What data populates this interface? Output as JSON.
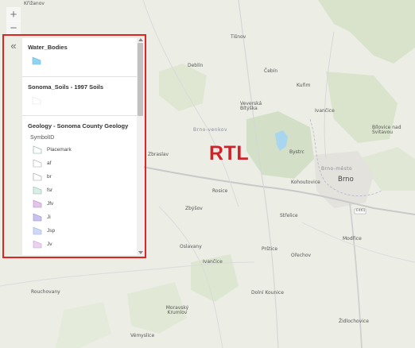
{
  "map": {
    "annotation": "RTL",
    "towns": [
      {
        "name": "Křižanov"
      },
      {
        "name": "Tišnov"
      },
      {
        "name": "Deblín"
      },
      {
        "name": "Čebín"
      },
      {
        "name": "Kuřim"
      },
      {
        "name": "Veverská Bítýška"
      },
      {
        "name": "Ivančice"
      },
      {
        "name": "Bílovice nad Svitavou"
      },
      {
        "name": "Brno-venkov"
      },
      {
        "name": "Zbraslav"
      },
      {
        "name": "Bystrc"
      },
      {
        "name": "Brno-město"
      },
      {
        "name": "Kohoutovice"
      },
      {
        "name": "Brno"
      },
      {
        "name": "Rosice"
      },
      {
        "name": "Zbýšov"
      },
      {
        "name": "Střelice"
      },
      {
        "name": "Modřice"
      },
      {
        "name": "Oslavany"
      },
      {
        "name": "Prštice"
      },
      {
        "name": "Ořechov"
      },
      {
        "name": "Ivančice"
      },
      {
        "name": "Rouchovany"
      },
      {
        "name": "Dolní Kounice"
      },
      {
        "name": "Moravský Krumlov"
      },
      {
        "name": "Židlochovice"
      },
      {
        "name": "Vémyslice"
      }
    ],
    "road_label": "E461"
  },
  "controls": {
    "zoom_in": "+",
    "zoom_out": "−",
    "collapse": "«"
  },
  "legend": {
    "layers": [
      {
        "title": "Water_Bodies"
      },
      {
        "title": "Sonoma_Soils - 1997 Soils"
      },
      {
        "title": "Geology - Sonoma County Geology",
        "field": "SymbolID",
        "items": [
          {
            "label": "Placemark",
            "color": "#ffffff",
            "stroke": "#7fa3a0"
          },
          {
            "label": "af",
            "color": "#ffffff",
            "stroke": "#9aa7b5"
          },
          {
            "label": "br",
            "color": "#ffffff",
            "stroke": "#9a9a9a"
          },
          {
            "label": "fsr",
            "color": "#d8efe6",
            "stroke": "#8fb8a8"
          },
          {
            "label": "Jfv",
            "color": "#e3c4ea",
            "stroke": "#b48cc0"
          },
          {
            "label": "Ji",
            "color": "#c9c1ef",
            "stroke": "#9a8fd0"
          },
          {
            "label": "Jsp",
            "color": "#cfd9f4",
            "stroke": "#9fb1d8"
          },
          {
            "label": "Jv",
            "color": "#ead2ef",
            "stroke": "#c4a3cc"
          }
        ]
      }
    ],
    "water_color": "#8fd3f2"
  }
}
